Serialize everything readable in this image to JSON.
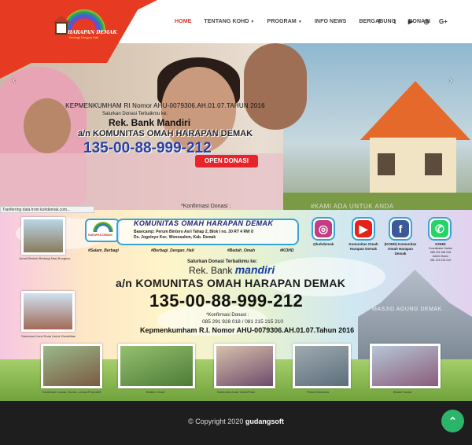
{
  "brand": {
    "title": "HARAPAN DEMAK",
    "tag": "Komunitas Omah",
    "subtitle": "Berbagi Dengan Hati"
  },
  "nav": [
    {
      "label": "HOME",
      "active": true,
      "caret": false
    },
    {
      "label": "TENTANG KOHD",
      "active": false,
      "caret": true
    },
    {
      "label": "PROGRAM",
      "active": false,
      "caret": true
    },
    {
      "label": "INFO NEWS",
      "active": false,
      "caret": false
    },
    {
      "label": "BERGABUNG",
      "active": false,
      "caret": false
    },
    {
      "label": "DONASI",
      "active": false,
      "caret": false
    }
  ],
  "social_icons": [
    "facebook-icon",
    "twitter-icon",
    "youtube-icon",
    "instagram-icon",
    "google-plus-icon"
  ],
  "social_glyphs": [
    "f",
    "t",
    "▶",
    "◎",
    "G+"
  ],
  "hero": {
    "registration": "KEPMENKUMHAM RI Nomor AHU-0079306.AH.01.07.TAHUN 2016",
    "channel": "Salurkan Donasi Terbaikmu ke:",
    "bank": "Rek. Bank Mandiri",
    "holder": "a/n KOMUNITAS OMAH HARAPAN DEMAK",
    "account": "135-00-88-999-212",
    "confirm": "*Konfirmasi Donasi :",
    "badge": "OPEN DONASI",
    "watermark": "#KAMI ADA UNTUK ANDA"
  },
  "status_bar": "Tranferring data from kohdemak.com...",
  "banner": {
    "title": "KOMUNITAS OMAH HARAPAN DEMAK",
    "basecamp": "Basecamp: Perum Bintoro Asri Tahap 2, Blok I no. 30 RT 4 RW 8",
    "address": "Ds. Jogoloyo Kec. Wonosalem, Kab. Demak",
    "hashtags": [
      "#Salam_Berbagi",
      "#Berbagi_Dengan_Hati",
      "#Bedah_Omah",
      "#KOHD"
    ],
    "socials": [
      {
        "name": "instagram",
        "label": "@kohdemak",
        "color": "#c53b84",
        "glyph": "◎"
      },
      {
        "name": "youtube",
        "label": "Komunitas Omah Harapan Demak",
        "color": "#e62117",
        "glyph": "▶"
      },
      {
        "name": "facebook",
        "label": "(KOHD) Komunitas Omah Harapan Demak",
        "color": "#3b5998",
        "glyph": "f"
      },
      {
        "name": "whatsapp",
        "label": "KOHD",
        "color": "#25d366",
        "glyph": "✆"
      }
    ],
    "whatsapp_detail": [
      "Koordinator Harian",
      "085 291 928 018",
      "Admin Hamo",
      "081 215 215 210"
    ],
    "donate_channel": "Salurkan Donasi Terbaikmu ke:",
    "donate_bank_prefix": "Rek. Bank",
    "donate_bank_name": "mandiri",
    "donate_holder": "a/n KOMUNITAS OMAH HARAPAN DEMAK",
    "donate_account": "135-00-88-999-212",
    "donate_confirm": "*Konfirmasi Donasi :",
    "donate_phones": "085 291 928 018 / 081 215 215 210",
    "donate_kemen": "Kepmenkumham R.I. Nomor AHU-0079306.AH.01.07.Tahun 2016",
    "mosque_text": "MASJID AGUNG DEMAK",
    "captions": [
      "Jumat Berkah Berbagi Nasi Bungkus",
      "Santunan Kursi Roda Untuk Disabilitas",
      "Santunan Lansia, Duafa, Lansia Produktif",
      "Bedah Omah",
      "Santunan Anak Yatim/Piatu",
      "Peduli Bencana",
      "Bhakti Sosial"
    ]
  },
  "footer": {
    "prefix": "© Copyright 2020",
    "brand": "gudangsoft"
  },
  "to_top_glyph": "⌃"
}
